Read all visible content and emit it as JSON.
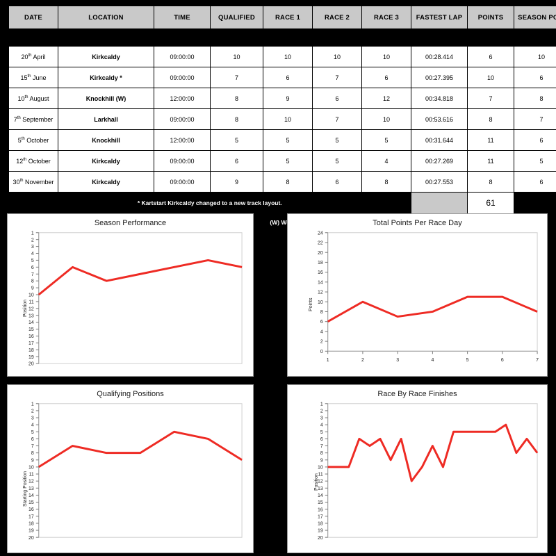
{
  "table": {
    "headers": [
      "DATE",
      "LOCATION",
      "TIME",
      "QUALIFIED",
      "RACE 1",
      "RACE 2",
      "RACE 3",
      "FASTEST LAP",
      "POINTS",
      "SEASON POS."
    ],
    "rows": [
      {
        "day": "20",
        "ord": "th",
        "month": "April",
        "location": "Kirkcaldy",
        "time": "09:00:00",
        "qualified": "10",
        "race1": "10",
        "race2": "10",
        "race3": "10",
        "fastest_lap": "00:28.414",
        "points": "6",
        "season_pos": "10"
      },
      {
        "day": "15",
        "ord": "th",
        "month": "June",
        "location": "Kirkcaldy *",
        "time": "09:00:00",
        "qualified": "7",
        "race1": "6",
        "race2": "7",
        "race3": "6",
        "fastest_lap": "00:27.395",
        "points": "10",
        "season_pos": "6"
      },
      {
        "day": "10",
        "ord": "th",
        "month": "August",
        "location": "Knockhill (W)",
        "time": "12:00:00",
        "qualified": "8",
        "race1": "9",
        "race2": "6",
        "race3": "12",
        "fastest_lap": "00:34.818",
        "points": "7",
        "season_pos": "8"
      },
      {
        "day": "7",
        "ord": "th",
        "month": "September",
        "location": "Larkhall",
        "time": "09:00:00",
        "qualified": "8",
        "race1": "10",
        "race2": "7",
        "race3": "10",
        "fastest_lap": "00:53.616",
        "points": "8",
        "season_pos": "7"
      },
      {
        "day": "5",
        "ord": "th",
        "month": "October",
        "location": "Knockhill",
        "time": "12:00:00",
        "qualified": "5",
        "race1": "5",
        "race2": "5",
        "race3": "5",
        "fastest_lap": "00:31.644",
        "points": "11",
        "season_pos": "6"
      },
      {
        "day": "12",
        "ord": "th",
        "month": "October",
        "location": "Kirkcaldy",
        "time": "09:00:00",
        "qualified": "6",
        "race1": "5",
        "race2": "5",
        "race3": "4",
        "fastest_lap": "00:27.269",
        "points": "11",
        "season_pos": "5"
      },
      {
        "day": "30",
        "ord": "th",
        "month": "November",
        "location": "Kirkcaldy",
        "time": "09:00:00",
        "qualified": "9",
        "race1": "8",
        "race2": "6",
        "race3": "8",
        "fastest_lap": "00:27.553",
        "points": "8",
        "season_pos": "6"
      }
    ],
    "total_points": "61",
    "footnote_1": "* Kartstart Kirkcaldy changed to a new track layout.",
    "footnote_2": "(W) Wet Race"
  },
  "chart_data": [
    {
      "type": "line",
      "title": "Season Performance",
      "xlabel": "",
      "ylabel": "Position",
      "x": [
        1,
        2,
        3,
        4,
        5,
        6,
        7
      ],
      "values": [
        10,
        6,
        8,
        7,
        6,
        5,
        6
      ],
      "ylim": [
        1,
        20
      ],
      "yticks": [
        1,
        2,
        3,
        4,
        5,
        6,
        7,
        8,
        9,
        10,
        11,
        12,
        13,
        14,
        15,
        16,
        17,
        18,
        19,
        20
      ],
      "xticklabels": [],
      "inverted_y": true,
      "grid": false,
      "line_color": "#ee2b24"
    },
    {
      "type": "line",
      "title": "Total Points Per Race Day",
      "xlabel": "",
      "ylabel": "Points",
      "x": [
        1,
        2,
        3,
        4,
        5,
        6,
        7
      ],
      "values": [
        6,
        10,
        7,
        8,
        11,
        11,
        8
      ],
      "ylim": [
        0,
        24
      ],
      "yticks": [
        0,
        2,
        4,
        6,
        8,
        10,
        12,
        14,
        16,
        18,
        20,
        22,
        24
      ],
      "xticklabels": [
        "1",
        "2",
        "3",
        "4",
        "5",
        "6",
        "7"
      ],
      "inverted_y": false,
      "grid": false,
      "line_color": "#ee2b24"
    },
    {
      "type": "line",
      "title": "Qualifying Positions",
      "xlabel": "",
      "ylabel": "Starting Position",
      "x": [
        1,
        2,
        3,
        4,
        5,
        6,
        7
      ],
      "values": [
        10,
        7,
        8,
        8,
        5,
        6,
        9
      ],
      "ylim": [
        1,
        20
      ],
      "yticks": [
        1,
        2,
        3,
        4,
        5,
        6,
        7,
        8,
        9,
        10,
        11,
        12,
        13,
        14,
        15,
        16,
        17,
        18,
        19,
        20
      ],
      "xticklabels": [],
      "inverted_y": true,
      "grid": false,
      "line_color": "#ee2b24"
    },
    {
      "type": "line",
      "title": "Race By Race Finishes",
      "xlabel": "",
      "ylabel": "Position",
      "x": [
        1,
        2,
        3,
        4,
        5,
        6,
        7,
        8,
        9,
        10,
        11,
        12,
        13,
        14,
        15,
        16,
        17,
        18,
        19,
        20,
        21
      ],
      "values": [
        10,
        10,
        10,
        6,
        7,
        6,
        9,
        6,
        12,
        10,
        7,
        10,
        5,
        5,
        5,
        5,
        5,
        4,
        8,
        6,
        8
      ],
      "ylim": [
        1,
        20
      ],
      "yticks": [
        1,
        2,
        3,
        4,
        5,
        6,
        7,
        8,
        9,
        10,
        11,
        12,
        13,
        14,
        15,
        16,
        17,
        18,
        19,
        20
      ],
      "xticklabels": [],
      "inverted_y": true,
      "grid": false,
      "line_color": "#ee2b24"
    }
  ]
}
